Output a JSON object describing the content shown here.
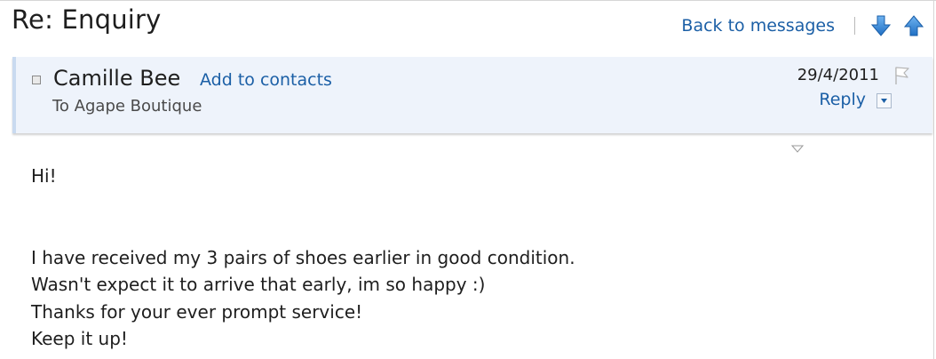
{
  "subject": "Re: Enquiry",
  "toolbar": {
    "back_label": "Back to messages",
    "next_icon": "arrow-down-icon",
    "prev_icon": "arrow-up-icon"
  },
  "header": {
    "sender": "Camille Bee",
    "add_contacts": "Add to contacts",
    "recipient": "To Agape Boutique",
    "date": "29/4/2011",
    "reply_label": "Reply",
    "flag_icon": "flag-icon",
    "dropdown_icon": "chevron-down-icon"
  },
  "message": {
    "greeting": "Hi!",
    "lines": [
      "I have received my 3 pairs of shoes earlier in good condition.",
      "Wasn't expect it to arrive that early, im so happy :)",
      "Thanks for your ever prompt service!",
      "Keep it up!"
    ]
  },
  "colors": {
    "link": "#1b5fa6",
    "header_bg": "#eef3fb",
    "accent_border": "#c9daf0",
    "arrow_blue": "#2d86d8"
  }
}
